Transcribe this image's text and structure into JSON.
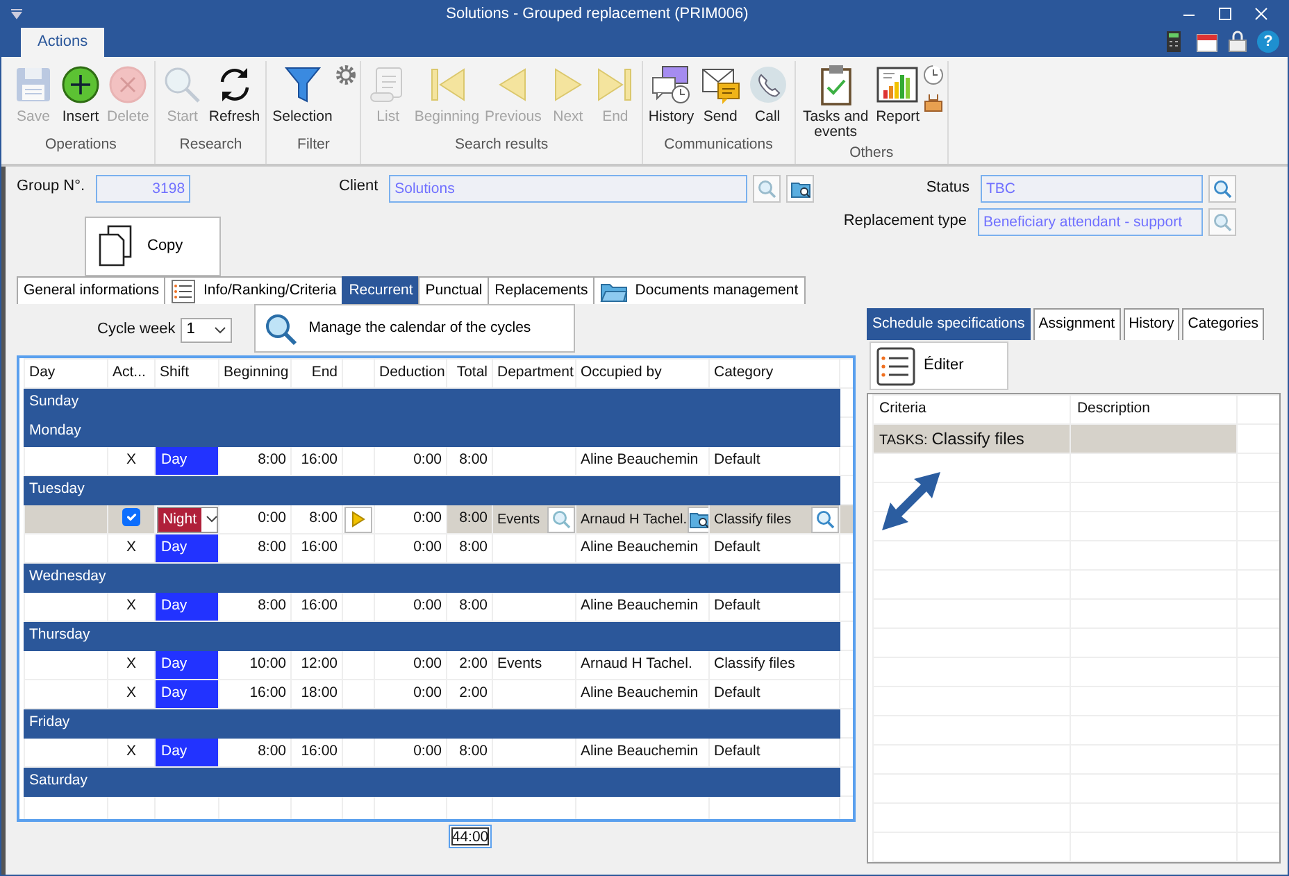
{
  "window": {
    "title": "Solutions - Grouped replacement (PRIM006)"
  },
  "ribbon": {
    "tabs": [
      {
        "label": "Actions",
        "selected": true
      }
    ],
    "help": "?",
    "groups": [
      {
        "label": "Operations",
        "buttons": [
          {
            "kind": "save",
            "label": "Save",
            "disabled": true
          },
          {
            "kind": "insert",
            "label": "Insert",
            "disabled": false
          },
          {
            "kind": "delete",
            "label": "Delete",
            "disabled": true
          }
        ]
      },
      {
        "label": "Research",
        "buttons": [
          {
            "kind": "start",
            "label": "Start",
            "disabled": true
          },
          {
            "kind": "refresh",
            "label": "Refresh",
            "disabled": false
          }
        ]
      },
      {
        "label": "Filter",
        "buttons": [
          {
            "kind": "selection",
            "label": "Selection",
            "disabled": false
          }
        ],
        "small_buttons": [
          {
            "kind": "settings"
          }
        ]
      },
      {
        "label": "Search results",
        "buttons": [
          {
            "kind": "list",
            "label": "List",
            "disabled": true
          },
          {
            "kind": "beginning",
            "label": "Beginning",
            "disabled": true
          },
          {
            "kind": "previous",
            "label": "Previous",
            "disabled": true
          },
          {
            "kind": "next",
            "label": "Next",
            "disabled": true
          },
          {
            "kind": "end",
            "label": "End",
            "disabled": true
          }
        ]
      },
      {
        "label": "Communications",
        "buttons": [
          {
            "kind": "history",
            "label": "History",
            "disabled": false
          },
          {
            "kind": "send",
            "label": "Send",
            "disabled": false
          },
          {
            "kind": "call",
            "label": "Call",
            "disabled": false
          }
        ]
      },
      {
        "label": "Others",
        "buttons": [
          {
            "kind": "tasks",
            "label": "Tasks and events",
            "disabled": false
          },
          {
            "kind": "report",
            "label": "Report",
            "disabled": false
          }
        ],
        "small_buttons": [
          {
            "kind": "clock"
          },
          {
            "kind": "tray"
          }
        ]
      }
    ]
  },
  "form": {
    "group_no": {
      "label": "Group N°.",
      "value": "3198"
    },
    "copy_button": "Copy",
    "client": {
      "label": "Client",
      "value": "Solutions"
    },
    "status": {
      "label": "Status",
      "value": "TBC"
    },
    "replacement_type": {
      "label": "Replacement type",
      "value": "Beneficiary attendant - support"
    }
  },
  "tabs": [
    {
      "label": "General informations",
      "selected": false
    },
    {
      "label": "Info/Ranking/Criteria",
      "selected": false,
      "kind": "list"
    },
    {
      "label": "Recurrent",
      "selected": true
    },
    {
      "label": "Punctual",
      "selected": false
    },
    {
      "label": "Replacements",
      "selected": false
    },
    {
      "label": "Documents management",
      "selected": false,
      "kind": "folder"
    }
  ],
  "cycle_week": {
    "label": "Cycle week",
    "value": "1"
  },
  "manage_button": "Manage the calendar of the cycles",
  "schedule": {
    "columns": [
      "Day",
      "Act...",
      "Shift",
      "Beginning",
      "End",
      "Deduction",
      "Total",
      "Department",
      "Occupied by",
      "Category"
    ],
    "rows": [
      {
        "kind": "day",
        "day": "Sunday"
      },
      {
        "kind": "day",
        "day": "Monday"
      },
      {
        "kind": "entry",
        "selected": false,
        "active": "X",
        "shift": {
          "label": "Day",
          "color": "#2233ff"
        },
        "beginning": "8:00",
        "end": "16:00",
        "deduction": "0:00",
        "total": "8:00",
        "occupied_by": "Aline Beauchemin",
        "category": "Default"
      },
      {
        "kind": "day",
        "day": "Tuesday"
      },
      {
        "kind": "entry",
        "selected": true,
        "checked": true,
        "shift": {
          "label": "Night",
          "color": "#b0203a"
        },
        "beginning": "0:00",
        "end": "8:00",
        "deduction": "0:00",
        "total": "8:00",
        "department": "Events",
        "occupied_by": "Arnaud H Tachel.",
        "category": "Classify files"
      },
      {
        "kind": "entry",
        "selected": false,
        "active": "X",
        "shift": {
          "label": "Day",
          "color": "#2233ff"
        },
        "beginning": "8:00",
        "end": "16:00",
        "deduction": "0:00",
        "total": "8:00",
        "occupied_by": "Aline Beauchemin",
        "category": "Default"
      },
      {
        "kind": "day",
        "day": "Wednesday"
      },
      {
        "kind": "entry",
        "selected": false,
        "active": "X",
        "shift": {
          "label": "Day",
          "color": "#2233ff"
        },
        "beginning": "8:00",
        "end": "16:00",
        "deduction": "0:00",
        "total": "8:00",
        "occupied_by": "Aline Beauchemin",
        "category": "Default"
      },
      {
        "kind": "day",
        "day": "Thursday"
      },
      {
        "kind": "entry",
        "selected": false,
        "active": "X",
        "shift": {
          "label": "Day",
          "color": "#2233ff"
        },
        "beginning": "10:00",
        "end": "12:00",
        "deduction": "0:00",
        "total": "2:00",
        "department": "Events",
        "occupied_by": "Arnaud H Tachel.",
        "category": "Classify files"
      },
      {
        "kind": "entry",
        "selected": false,
        "active": "X",
        "shift": {
          "label": "Day",
          "color": "#2233ff"
        },
        "beginning": "16:00",
        "end": "18:00",
        "deduction": "0:00",
        "total": "2:00",
        "occupied_by": "Aline Beauchemin",
        "category": "Default"
      },
      {
        "kind": "day",
        "day": "Friday"
      },
      {
        "kind": "entry",
        "selected": false,
        "active": "X",
        "shift": {
          "label": "Day",
          "color": "#2233ff"
        },
        "beginning": "8:00",
        "end": "16:00",
        "deduction": "0:00",
        "total": "8:00",
        "occupied_by": "Aline Beauchemin",
        "category": "Default"
      },
      {
        "kind": "day",
        "day": "Saturday"
      }
    ],
    "total": "44:00"
  },
  "side": {
    "tabs": [
      {
        "label": "Schedule specifications",
        "selected": true
      },
      {
        "label": "Assignment",
        "selected": false
      },
      {
        "label": "History",
        "selected": false
      },
      {
        "label": "Categories",
        "selected": false
      }
    ],
    "edit_button": "Éditer",
    "columns": [
      "Criteria",
      "Description"
    ],
    "rows": [
      {
        "tag": "TASKS:",
        "value": "Classify files",
        "selected": true
      }
    ]
  }
}
